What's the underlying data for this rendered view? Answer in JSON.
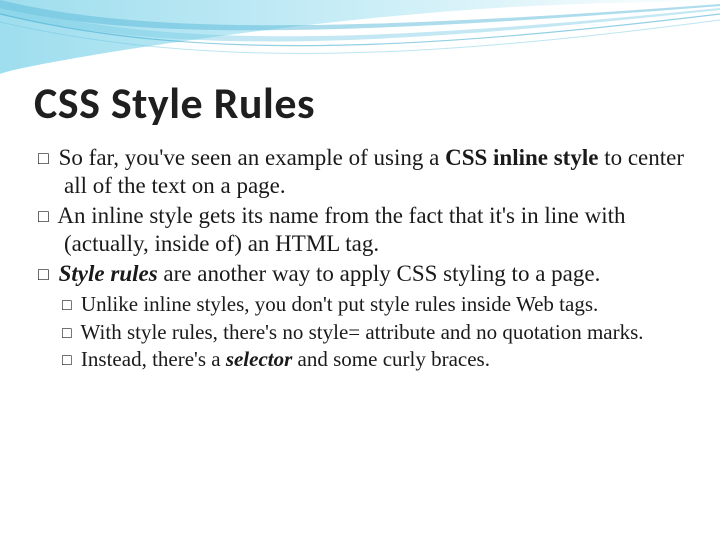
{
  "title": "CSS Style Rules",
  "bullets": [
    {
      "pre": "So far, you've seen an example of using a ",
      "bold": "CSS inline style",
      "post": " to center all of the text on a page."
    },
    {
      "pre": " An inline style gets its name from the fact that it's in line with (actually, inside of) an HTML tag.",
      "bold": "",
      "post": ""
    },
    {
      "pre": "",
      "bold_i": "Style rules",
      "post": " are another way to apply CSS styling to a page."
    }
  ],
  "sub": [
    {
      "pre": "Unlike inline styles, you don't put style rules inside Web tags.",
      "bold": "",
      "post": ""
    },
    {
      "pre": "With style rules, there's no style= attribute and no quotation marks.",
      "bold": "",
      "post": ""
    },
    {
      "pre": "Instead, there's a ",
      "bold_i": "selector",
      "post": " and some curly braces."
    }
  ]
}
